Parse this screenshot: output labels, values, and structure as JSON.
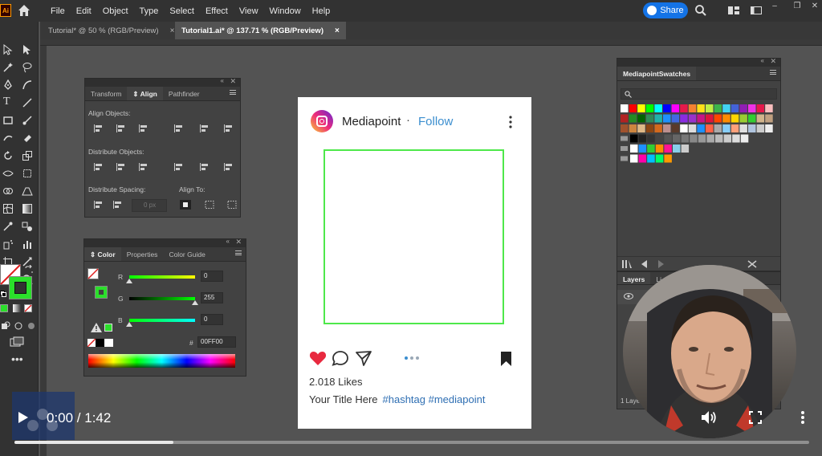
{
  "app": {
    "logo": "Ai",
    "menu": [
      "File",
      "Edit",
      "Object",
      "Type",
      "Select",
      "Effect",
      "View",
      "Window",
      "Help"
    ],
    "share_label": "Share",
    "win_controls": [
      "–",
      "❐",
      "✕"
    ]
  },
  "documents": {
    "tabs": [
      {
        "label": "Tutorial* @ 50 % (RGB/Preview)",
        "close": "×"
      },
      {
        "label": "Tutorial1.ai* @ 137.71 % (RGB/Preview)",
        "close": "×"
      }
    ]
  },
  "align_panel": {
    "tabs": [
      "Transform",
      "Align",
      "Pathfinder"
    ],
    "align_objects": "Align Objects:",
    "distribute_objects": "Distribute Objects:",
    "distribute_spacing": "Distribute Spacing:",
    "align_to": "Align To:",
    "spacing_value": "0 px"
  },
  "color_panel": {
    "tabs": [
      "Color",
      "Properties",
      "Color Guide"
    ],
    "channels": [
      {
        "label": "R",
        "value": "0"
      },
      {
        "label": "G",
        "value": "255"
      },
      {
        "label": "B",
        "value": "0"
      }
    ],
    "hex_symbol": "#",
    "hex": "00FF00"
  },
  "swatches_panel": {
    "title": "MediapointSwatches"
  },
  "layers_panel": {
    "tabs": [
      "Layers",
      "Li"
    ],
    "footer": "1 Layer"
  },
  "post": {
    "profile_name": "Mediapoint",
    "separator": "·",
    "follow": "Follow",
    "likes": "2.018 Likes",
    "caption": "Your Title Here",
    "hashtags": "#hashtag #mediapoint",
    "frame_color": "#4ee84a"
  },
  "video": {
    "time": "0:00 / 1:42",
    "progress": 0.2
  }
}
